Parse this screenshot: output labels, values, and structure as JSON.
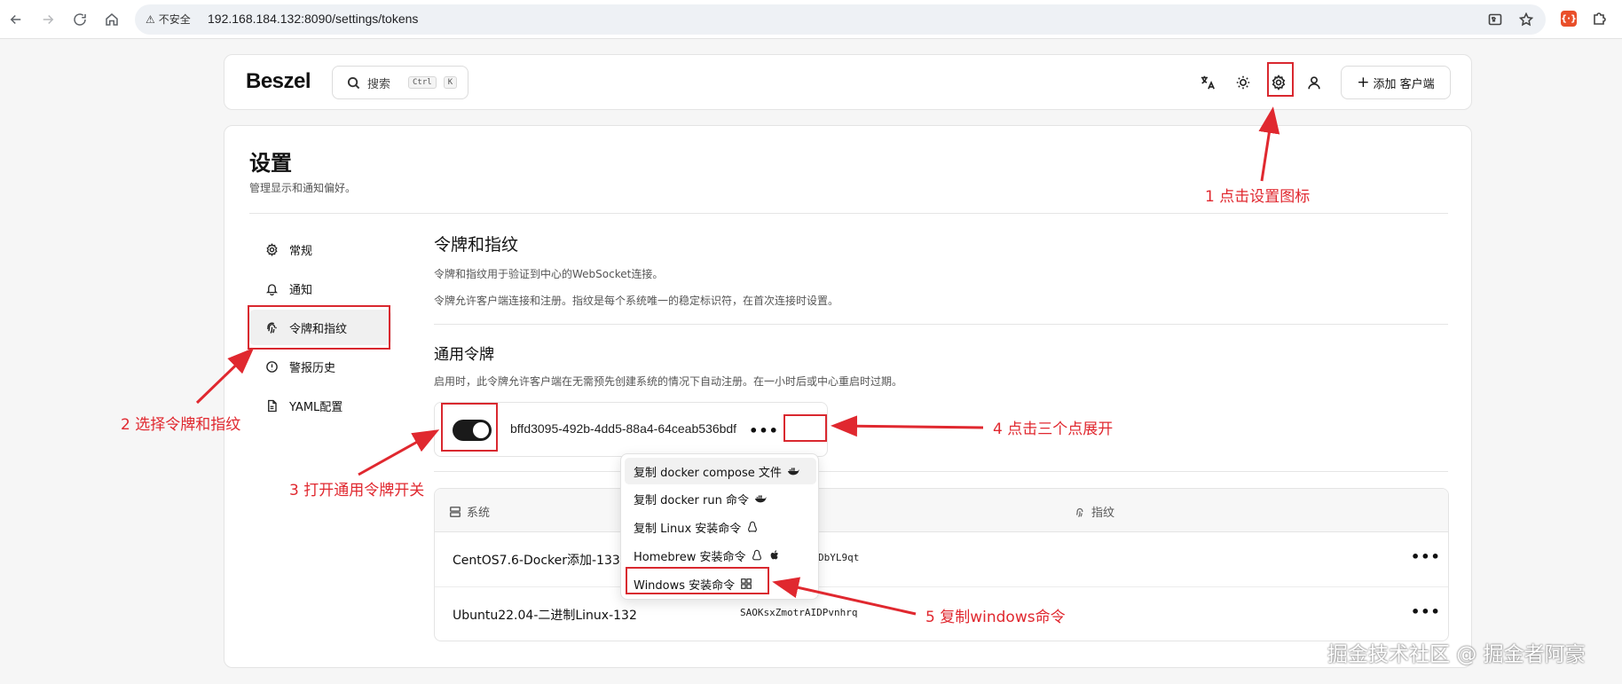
{
  "browser": {
    "security_label": "不安全",
    "url": "192.168.184.132:8090/settings/tokens"
  },
  "header": {
    "logo": "Beszel",
    "search_placeholder": "搜索",
    "search_kbd": [
      "Ctrl",
      "K"
    ],
    "add_client_label": "添加 客户端"
  },
  "settings": {
    "title": "设置",
    "subtitle": "管理显示和通知偏好。",
    "sidebar": [
      {
        "label": "常规",
        "icon": "gear-icon"
      },
      {
        "label": "通知",
        "icon": "bell-icon"
      },
      {
        "label": "令牌和指纹",
        "icon": "fingerprint-icon",
        "active": true
      },
      {
        "label": "警报历史",
        "icon": "alert-circle-icon"
      },
      {
        "label": "YAML配置",
        "icon": "file-icon"
      }
    ]
  },
  "tokens": {
    "title": "令牌和指纹",
    "desc1": "令牌和指纹用于验证到中心的WebSocket连接。",
    "desc2": "令牌允许客户端连接和注册。指纹是每个系统唯一的稳定标识符，在首次连接时设置。",
    "universal_title": "通用令牌",
    "universal_desc": "启用时，此令牌允许客户端在无需预先创建系统的情况下自动注册。在一小时后或中心重启时过期。",
    "token_enabled": true,
    "token_value": "bffd3095-492b-4dd5-88a4-64ceab536bdf",
    "menu_items": [
      {
        "label": "复制 docker compose 文件",
        "icons": [
          "docker-icon"
        ]
      },
      {
        "label": "复制 docker run 命令",
        "icons": [
          "docker-icon"
        ]
      },
      {
        "label": "复制 Linux 安装命令",
        "icons": [
          "linux-icon"
        ]
      },
      {
        "label": "Homebrew 安装命令",
        "icons": [
          "linux-icon",
          "apple-icon"
        ]
      },
      {
        "label": "Windows 安装命令",
        "icons": [
          "windows-icon"
        ]
      }
    ],
    "table": {
      "col_system": "系统",
      "col_fingerprint": "指纹",
      "rows": [
        {
          "system": "CentOS7.6-Docker添加-133",
          "fingerprint": "DbYL9qt"
        },
        {
          "system": "Ubuntu22.04-二进制Linux-132",
          "fingerprint": "SAOKsxZmotrAIDPvnhrq"
        }
      ]
    }
  },
  "annotations": {
    "step1": "1 点击设置图标",
    "step2": "2 选择令牌和指纹",
    "step3": "3 打开通用令牌开关",
    "step4": "4 点击三个点展开",
    "step5": "5 复制windows命令",
    "color": "#e0282f"
  },
  "watermark": "掘金技术社区 @ 掘金者阿豪"
}
